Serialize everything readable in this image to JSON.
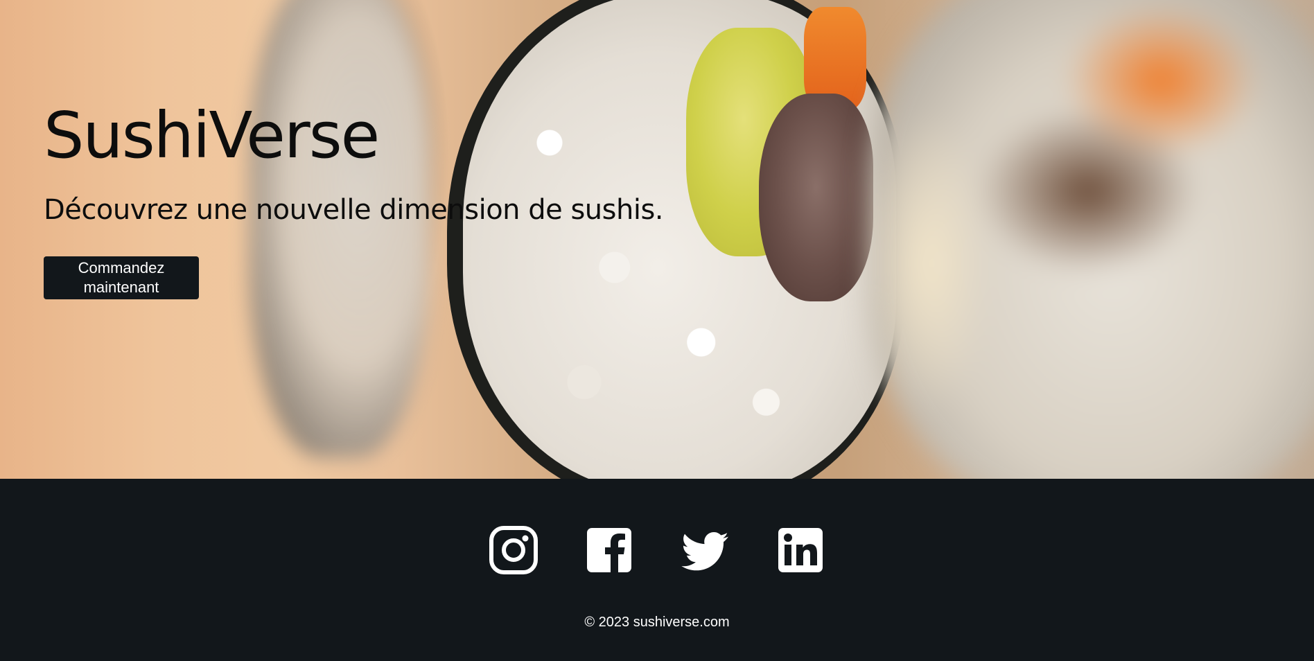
{
  "hero": {
    "title": "SushiVerse",
    "tagline": "Découvrez une nouvelle dimension de sushis.",
    "cta_label": "Commandez maintenant",
    "image_subject": "sushi-roll-photo"
  },
  "footer": {
    "social": [
      {
        "name": "instagram",
        "icon": "instagram-icon"
      },
      {
        "name": "facebook",
        "icon": "facebook-icon"
      },
      {
        "name": "twitter",
        "icon": "twitter-icon"
      },
      {
        "name": "linkedin",
        "icon": "linkedin-icon"
      }
    ],
    "copyright": "© 2023 sushiverse.com"
  },
  "colors": {
    "footer_bg": "#12171b",
    "button_bg": "#12171b",
    "text_dark": "#0d0d0d",
    "text_light": "#ffffff"
  }
}
